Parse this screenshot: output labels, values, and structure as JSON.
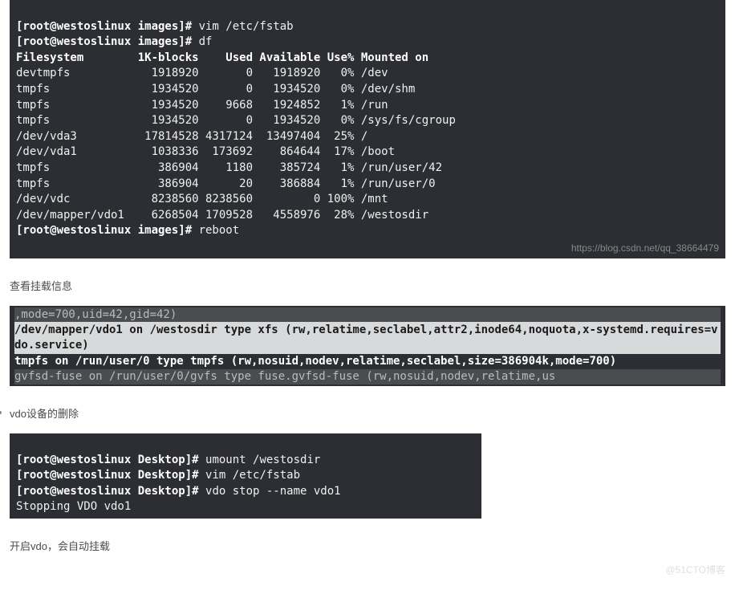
{
  "term1": {
    "prompt1": "[root@westoslinux images]# ",
    "cmd1": "vim /etc/fstab",
    "prompt2": "[root@westoslinux images]# ",
    "cmd2": "df",
    "header": "Filesystem        1K-blocks    Used Available Use% Mounted on",
    "rows": [
      "devtmpfs            1918920       0   1918920   0% /dev",
      "tmpfs               1934520       0   1934520   0% /dev/shm",
      "tmpfs               1934520    9668   1924852   1% /run",
      "tmpfs               1934520       0   1934520   0% /sys/fs/cgroup",
      "/dev/vda3          17814528 4317124  13497404  25% /",
      "/dev/vda1           1038336  173692    864644  17% /boot",
      "tmpfs                386904    1180    385724   1% /run/user/42",
      "tmpfs                386904      20    386884   1% /run/user/0",
      "/dev/vdc            8238560 8238560         0 100% /mnt",
      "/dev/mapper/vdo1    6268504 1709528   4558976  28% /westosdir"
    ],
    "prompt3": "[root@westoslinux images]# ",
    "cmd3": "reboot",
    "watermark": "https://blog.csdn.net/qq_38664479"
  },
  "label1": "查看挂载信息",
  "term2": {
    "line1": ",mode=700,uid=42,gid=42)",
    "line2": "/dev/mapper/vdo1 on /westosdir type xfs (rw,relatime,seclabel,attr2,inode64,noquota,x-systemd.requires=vdo.service)",
    "line3": "tmpfs on /run/user/0 type tmpfs (rw,nosuid,nodev,relatime,seclabel,size=386904k,mode=700)",
    "line4": "gvfsd-fuse on /run/user/0/gvfs type fuse.gvfsd-fuse (rw,nosuid,nodev,relatime,us"
  },
  "label2": "vdo设备的删除",
  "term3": {
    "prompt1": "[root@westoslinux Desktop]# ",
    "cmd1": "umount /westosdir",
    "prompt2": "[root@westoslinux Desktop]# ",
    "cmd2": "vim /etc/fstab",
    "prompt3": "[root@westoslinux Desktop]# ",
    "cmd3": "vdo stop --name vdo1",
    "out1": "Stopping VDO vdo1"
  },
  "label3": "开启vdo，会自动挂载",
  "page_watermark": "@51CTO博客"
}
